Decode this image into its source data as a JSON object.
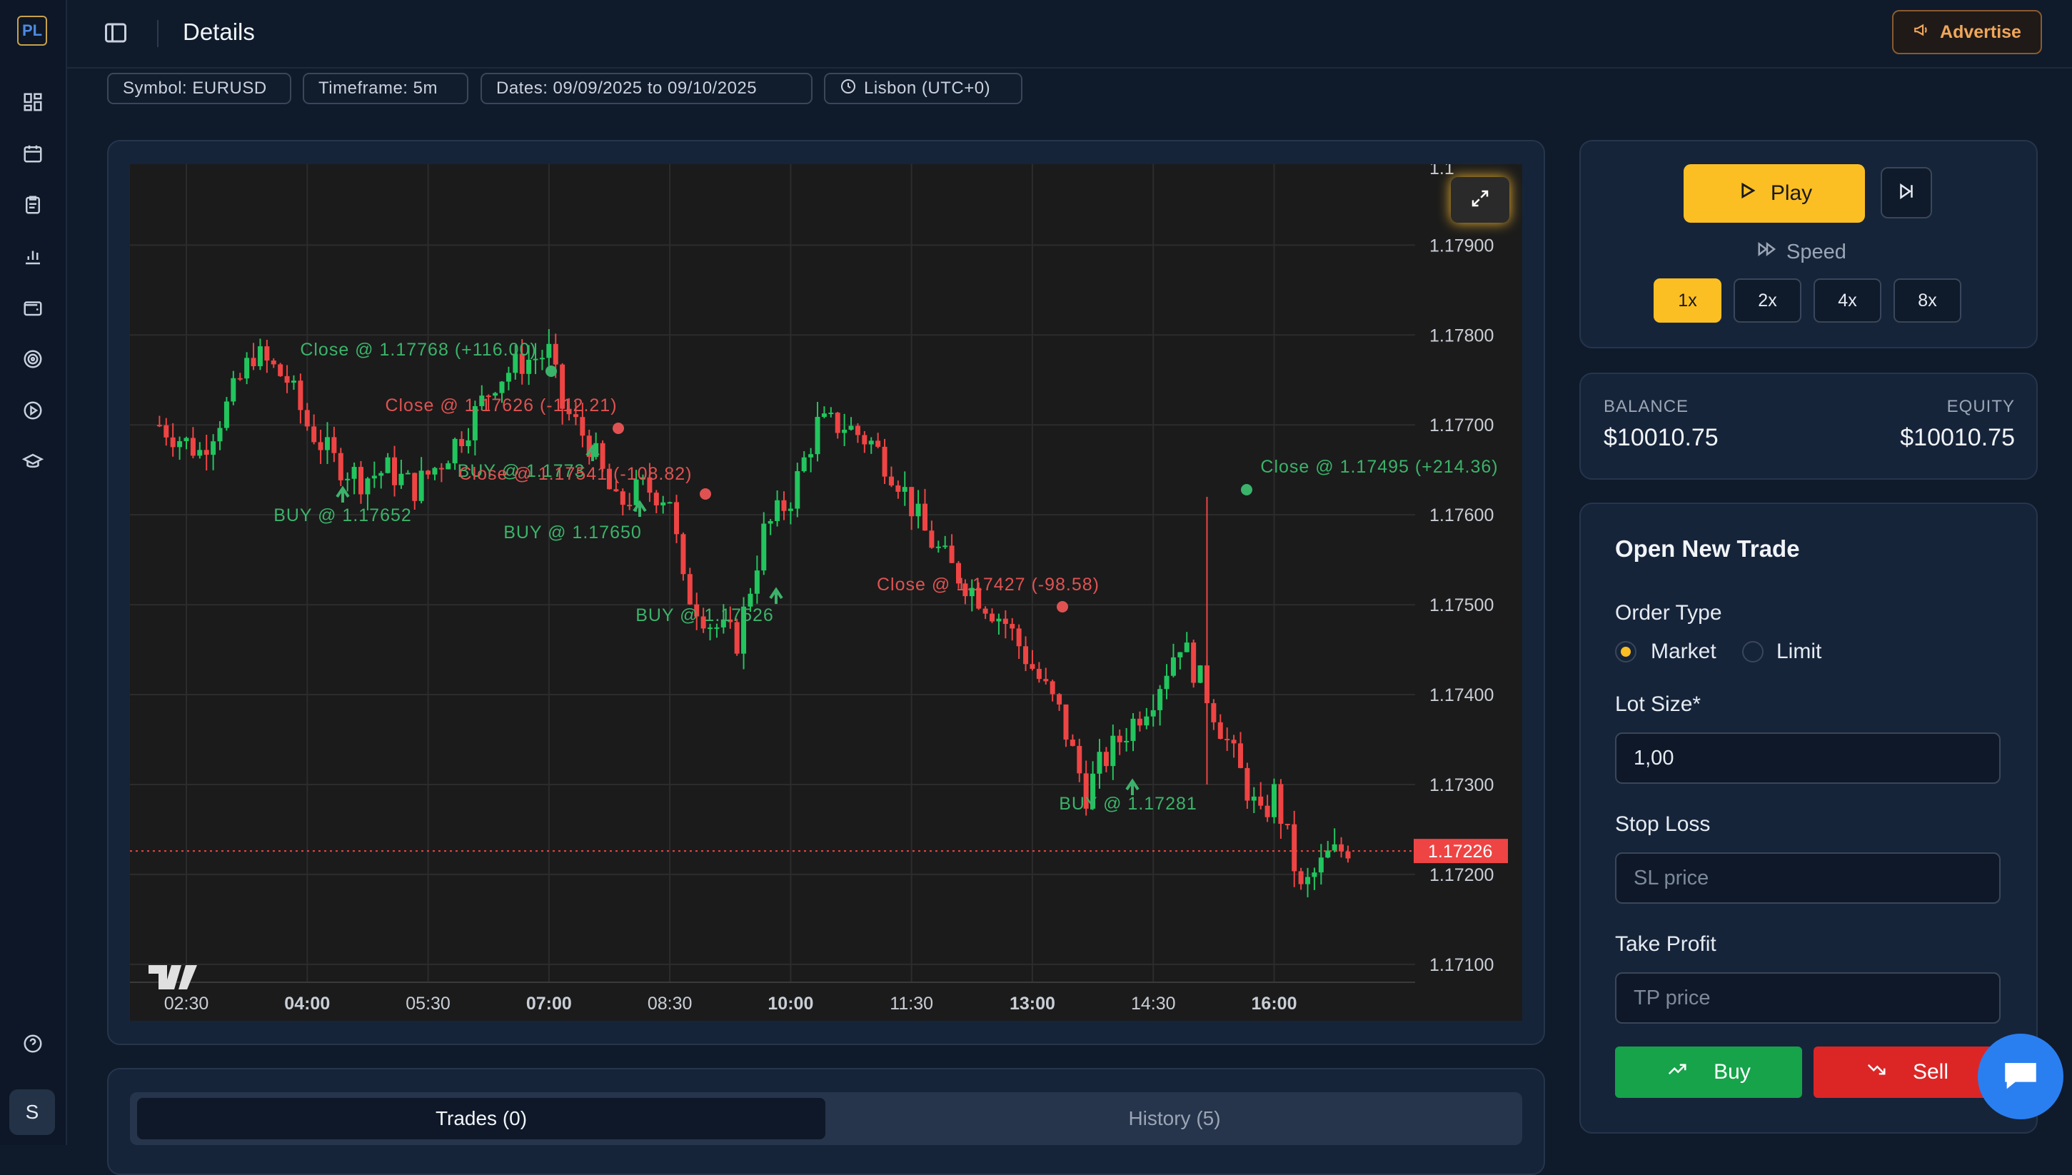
{
  "header": {
    "title": "Details",
    "advertise_label": "Advertise"
  },
  "sidebar": {
    "avatar_letter": "S"
  },
  "filters": {
    "symbol": "Symbol:  EURUSD",
    "timeframe": "Timeframe:  5m",
    "dates": "Dates:  09/09/2025 to 09/10/2025",
    "timezone": "Lisbon (UTC+0)"
  },
  "chart": {
    "current_price": "1.17226",
    "price_ticks": [
      "1.17900",
      "1.17800",
      "1.17700",
      "1.17600",
      "1.17500",
      "1.17400",
      "1.17300",
      "1.17200",
      "1.17100"
    ],
    "price_top_partial": "1.1",
    "time_ticks": [
      {
        "label": "02:30",
        "bold": false
      },
      {
        "label": "04:00",
        "bold": true
      },
      {
        "label": "05:30",
        "bold": false
      },
      {
        "label": "07:00",
        "bold": true
      },
      {
        "label": "08:30",
        "bold": false
      },
      {
        "label": "10:00",
        "bold": true
      },
      {
        "label": "11:30",
        "bold": false
      },
      {
        "label": "13:00",
        "bold": true
      },
      {
        "label": "14:30",
        "bold": false
      },
      {
        "label": "16:00",
        "bold": true
      }
    ],
    "annotations": [
      {
        "text": "Close @ 1.17768 (+116.00)",
        "color": "#3bb36a"
      },
      {
        "text": "Close @ 1.17626 (-112.21)",
        "color": "#e05252"
      },
      {
        "text": "BUY @ 1.17652",
        "color": "#3bb36a"
      },
      {
        "text": "BUY @ 1.1773",
        "color": "#3bb36a"
      },
      {
        "text": "Close @ 1.17541 (-108.82)",
        "color": "#e05252"
      },
      {
        "text": "BUY @ 1.17650",
        "color": "#3bb36a"
      },
      {
        "text": "BUY @ 1.17526",
        "color": "#3bb36a"
      },
      {
        "text": "Close @ 1.17427 (-98.58)",
        "color": "#e05252"
      },
      {
        "text": "Close @ 1.17495 (+214.36)",
        "color": "#3bb36a"
      },
      {
        "text": "BUY @ 1.17281",
        "color": "#3bb36a"
      }
    ]
  },
  "chart_data": {
    "type": "candlestick",
    "symbol": "EURUSD",
    "timeframe": "5m",
    "ylim": [
      1.1708,
      1.1799
    ],
    "x_ticks": [
      "02:30",
      "04:00",
      "05:30",
      "07:00",
      "08:30",
      "10:00",
      "11:30",
      "13:00",
      "14:30",
      "16:00"
    ],
    "last_price": 1.17226,
    "close_path": [
      [
        "02:10",
        1.177
      ],
      [
        "02:40",
        1.1767
      ],
      [
        "03:00",
        1.1772
      ],
      [
        "03:20",
        1.1778
      ],
      [
        "03:45",
        1.1775
      ],
      [
        "04:00",
        1.177
      ],
      [
        "04:20",
        1.1766
      ],
      [
        "04:40",
        1.1764
      ],
      [
        "05:00",
        1.1765
      ],
      [
        "05:20",
        1.1763
      ],
      [
        "05:40",
        1.1766
      ],
      [
        "06:00",
        1.177
      ],
      [
        "06:20",
        1.1775
      ],
      [
        "06:40",
        1.1777
      ],
      [
        "07:00",
        1.1778
      ],
      [
        "07:10",
        1.1772
      ],
      [
        "07:30",
        1.1768
      ],
      [
        "07:50",
        1.1761
      ],
      [
        "08:10",
        1.1763
      ],
      [
        "08:30",
        1.1762
      ],
      [
        "08:40",
        1.1752
      ],
      [
        "09:00",
        1.1748
      ],
      [
        "09:20",
        1.1746
      ],
      [
        "09:40",
        1.1758
      ],
      [
        "10:00",
        1.1762
      ],
      [
        "10:20",
        1.177
      ],
      [
        "10:40",
        1.177
      ],
      [
        "11:00",
        1.1768
      ],
      [
        "11:20",
        1.1764
      ],
      [
        "11:40",
        1.1758
      ],
      [
        "12:00",
        1.1754
      ],
      [
        "12:20",
        1.1751
      ],
      [
        "12:40",
        1.1748
      ],
      [
        "13:00",
        1.1743
      ],
      [
        "13:20",
        1.1738
      ],
      [
        "13:40",
        1.1729
      ],
      [
        "13:50",
        1.1732
      ],
      [
        "14:10",
        1.1736
      ],
      [
        "14:30",
        1.174
      ],
      [
        "14:50",
        1.1746
      ],
      [
        "15:10",
        1.174
      ],
      [
        "15:30",
        1.1733
      ],
      [
        "15:50",
        1.1726
      ],
      [
        "16:00",
        1.1729
      ],
      [
        "16:10",
        1.1724
      ],
      [
        "16:20",
        1.1718
      ],
      [
        "16:40",
        1.1722
      ],
      [
        "16:55",
        1.1723
      ]
    ]
  },
  "controls": {
    "play_label": "Play",
    "speed_label": "Speed",
    "speeds": [
      "1x",
      "2x",
      "4x",
      "8x"
    ],
    "active_speed": "1x"
  },
  "account": {
    "balance_label": "BALANCE",
    "balance": "$10010.75",
    "equity_label": "EQUITY",
    "equity": "$10010.75"
  },
  "trade_form": {
    "title": "Open New Trade",
    "order_type_label": "Order Type",
    "market_label": "Market",
    "limit_label": "Limit",
    "lot_size_label": "Lot Size*",
    "lot_size_value": "1,00",
    "stop_loss_label": "Stop Loss",
    "sl_placeholder": "SL price",
    "take_profit_label": "Take Profit",
    "tp_placeholder": "TP price",
    "buy_label": "Buy",
    "sell_label": "Sell"
  },
  "tabs": {
    "trades": "Trades (0)",
    "history": "History (5)"
  },
  "colors": {
    "accent": "#fbbf24",
    "buy": "#16a34a",
    "sell": "#dc2626",
    "up": "#22c55e",
    "down": "#ef4444"
  }
}
